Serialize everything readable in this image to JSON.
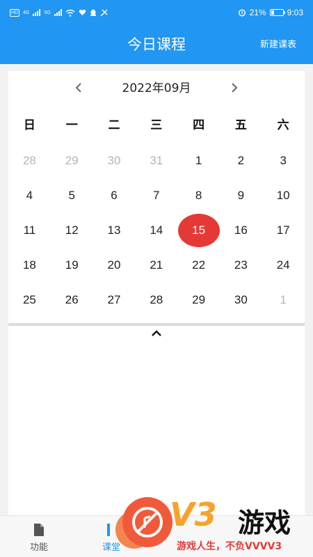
{
  "status_bar": {
    "left_pill": "HD",
    "net1": "4G",
    "net2": "5G",
    "battery": "21%",
    "time": "9:03"
  },
  "app_bar": {
    "title": "今日课程",
    "action": "新建课表"
  },
  "calendar": {
    "month_title": "2022年09月",
    "weekdays": [
      "日",
      "一",
      "二",
      "三",
      "四",
      "五",
      "六"
    ],
    "weeks": [
      [
        {
          "d": "28",
          "m": true
        },
        {
          "d": "29",
          "m": true
        },
        {
          "d": "30",
          "m": true
        },
        {
          "d": "31",
          "m": true
        },
        {
          "d": "1"
        },
        {
          "d": "2"
        },
        {
          "d": "3"
        }
      ],
      [
        {
          "d": "4"
        },
        {
          "d": "5"
        },
        {
          "d": "6"
        },
        {
          "d": "7"
        },
        {
          "d": "8"
        },
        {
          "d": "9"
        },
        {
          "d": "10"
        }
      ],
      [
        {
          "d": "11"
        },
        {
          "d": "12"
        },
        {
          "d": "13"
        },
        {
          "d": "14"
        },
        {
          "d": "15",
          "sel": true
        },
        {
          "d": "16"
        },
        {
          "d": "17"
        }
      ],
      [
        {
          "d": "18"
        },
        {
          "d": "19"
        },
        {
          "d": "20"
        },
        {
          "d": "21"
        },
        {
          "d": "22"
        },
        {
          "d": "23"
        },
        {
          "d": "24"
        }
      ],
      [
        {
          "d": "25"
        },
        {
          "d": "26"
        },
        {
          "d": "27"
        },
        {
          "d": "28"
        },
        {
          "d": "29"
        },
        {
          "d": "30"
        },
        {
          "d": "1",
          "m": true
        }
      ]
    ],
    "selected_color": "#e53935"
  },
  "bottom_nav": {
    "items": [
      {
        "label": "功能",
        "icon": "document-icon"
      },
      {
        "label": "课堂",
        "icon": "class-icon"
      }
    ]
  },
  "watermark": {
    "brand": "V3",
    "name": "游戏",
    "slogan": "游戏人生，不负VVVV3"
  },
  "colors": {
    "primary": "#2196f3",
    "accent": "#e53935"
  }
}
